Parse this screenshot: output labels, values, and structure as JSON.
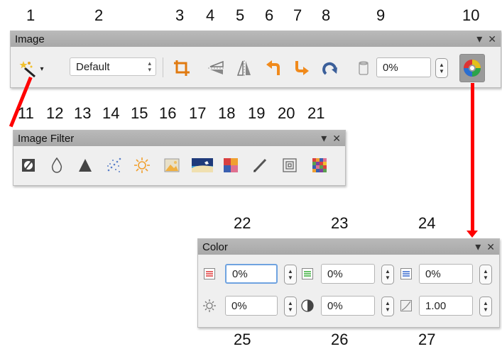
{
  "numbers": [
    "1",
    "2",
    "3",
    "4",
    "5",
    "6",
    "7",
    "8",
    "9",
    "10",
    "11",
    "12",
    "13",
    "14",
    "15",
    "16",
    "17",
    "18",
    "19",
    "20",
    "21",
    "22",
    "23",
    "24",
    "25",
    "26",
    "27"
  ],
  "image_toolbar": {
    "title": "Image",
    "filter_mode": "Default",
    "transparency": "0%"
  },
  "filter_toolbar": {
    "title": "Image Filter"
  },
  "color_toolbar": {
    "title": "Color",
    "red": "0%",
    "green": "0%",
    "blue": "0%",
    "brightness": "0%",
    "contrast": "0%",
    "gamma": "1.00"
  },
  "icons": {
    "collapse": "▾",
    "close": "✕"
  },
  "colors": {
    "annotation_line": "#ff0000",
    "title_bar": "#adadad",
    "focus": "#6fa3e0"
  }
}
